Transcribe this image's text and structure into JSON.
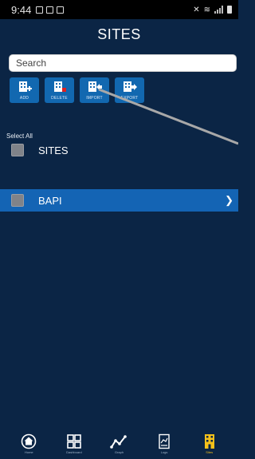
{
  "status_bar": {
    "time": "9:44"
  },
  "header": {
    "title": "SITES"
  },
  "search": {
    "placeholder": "Search"
  },
  "toolbar": {
    "add_label": "ADD",
    "delete_label": "DELETE",
    "import_label": "IMPORT",
    "export_label": "EXPORT"
  },
  "list": {
    "select_all_label": "Select All",
    "rows": [
      {
        "label": "SITES"
      },
      {
        "label": "BAPI"
      }
    ]
  },
  "bottom_nav": {
    "items": [
      {
        "label": "Home",
        "icon": "home-icon"
      },
      {
        "label": "Dashboard",
        "icon": "dashboard-icon"
      },
      {
        "label": "Graph",
        "icon": "graph-icon"
      },
      {
        "label": "Logs",
        "icon": "logs-icon"
      },
      {
        "label": "Sites",
        "icon": "sites-icon"
      }
    ]
  },
  "colors": {
    "background": "#0b2545",
    "toolbar_button": "#1268b0",
    "selected_row": "#1464b4",
    "active_nav": "#f5c11a"
  }
}
